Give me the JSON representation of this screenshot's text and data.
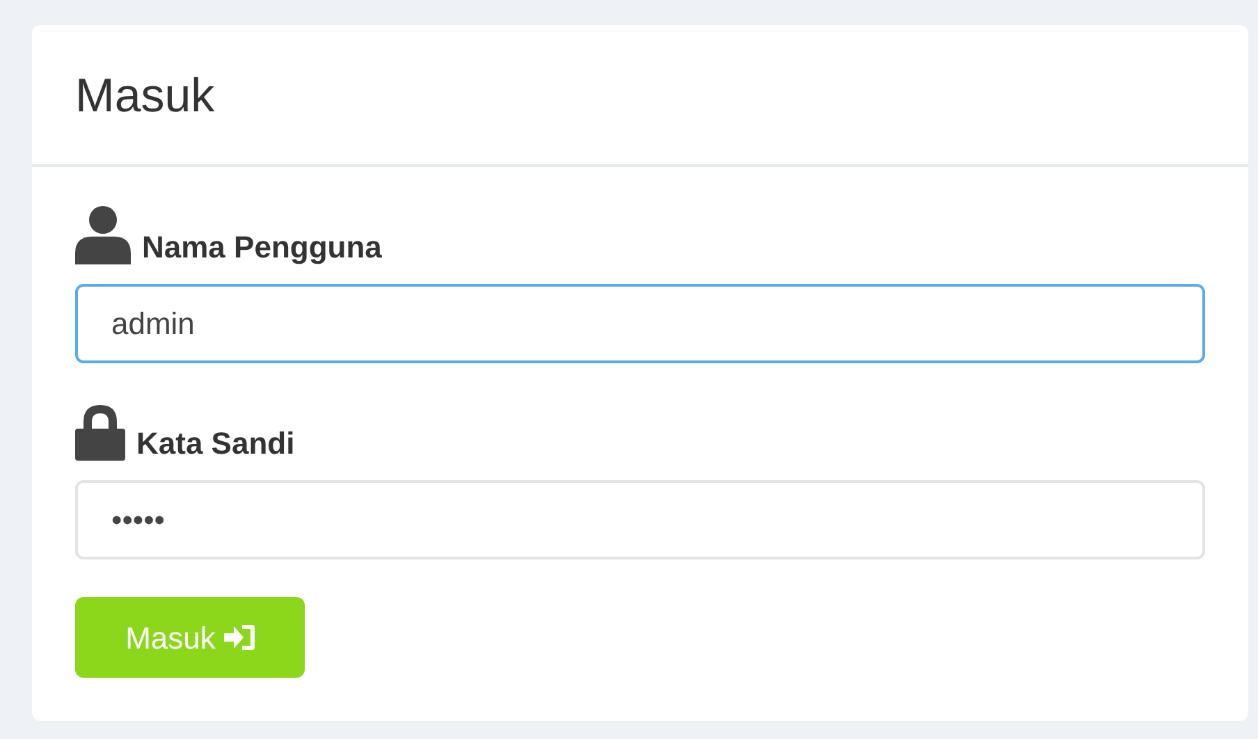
{
  "panel": {
    "title": "Masuk"
  },
  "fields": [
    {
      "kind": "user",
      "label": "Nama Pengguna",
      "value": "admin",
      "focused": true
    },
    {
      "kind": "lock",
      "label": "Kata Sandi",
      "value": "•••••",
      "focused": false
    }
  ],
  "submit_button": {
    "label": "Masuk"
  }
}
